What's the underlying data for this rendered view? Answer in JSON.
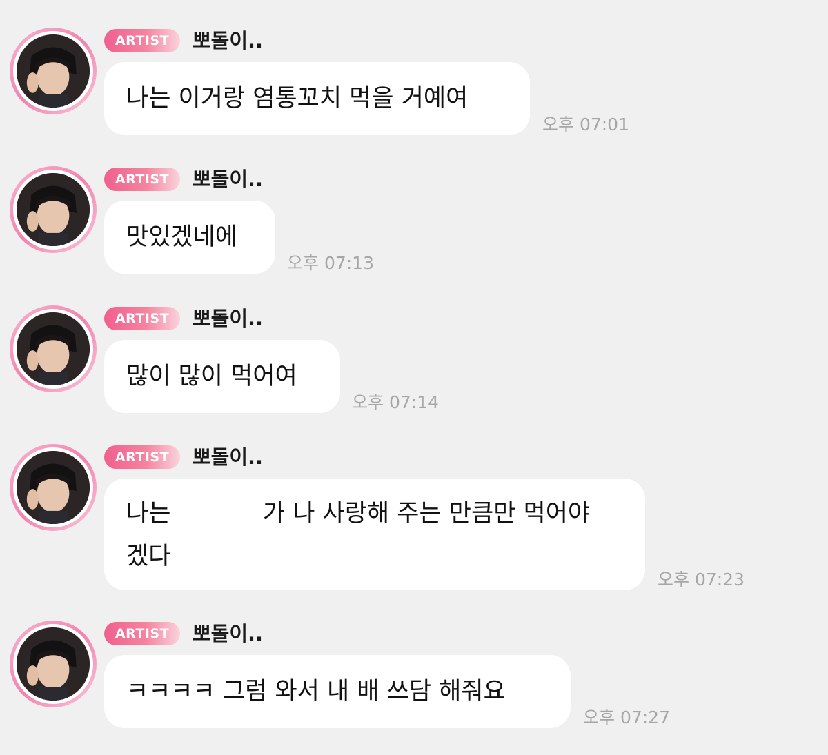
{
  "messages": [
    {
      "badge": "ARTIST",
      "name": "뽀돌이..",
      "lines": [
        "나는 이거랑 염통꼬치 먹을 거예여"
      ],
      "time": "오후 07:01"
    },
    {
      "badge": "ARTIST",
      "name": "뽀돌이..",
      "lines": [
        "맛있겠네에"
      ],
      "time": "오후 07:13"
    },
    {
      "badge": "ARTIST",
      "name": "뽀돌이..",
      "lines": [
        "많이 많이 먹어여"
      ],
      "time": "오후 07:14"
    },
    {
      "badge": "ARTIST",
      "name": "뽀돌이..",
      "lines": [
        "나는            가 나 사랑해 주는 만큼만 먹어야",
        "겠다"
      ],
      "time": "오후 07:23"
    },
    {
      "badge": "ARTIST",
      "name": "뽀돌이..",
      "lines": [
        "ㅋㅋㅋㅋ 그럼 와서 내 배 쓰담 해줘요"
      ],
      "time": "오후 07:27"
    }
  ],
  "colors": {
    "background": "#f0f0f0",
    "bubble": "#ffffff",
    "badge_start": "#f0608e",
    "badge_end": "#fad3dc",
    "avatar_ring": "#f283ae",
    "timestamp": "#a6a6a6"
  },
  "icons": {
    "avatar": "artist-profile-avatar"
  }
}
